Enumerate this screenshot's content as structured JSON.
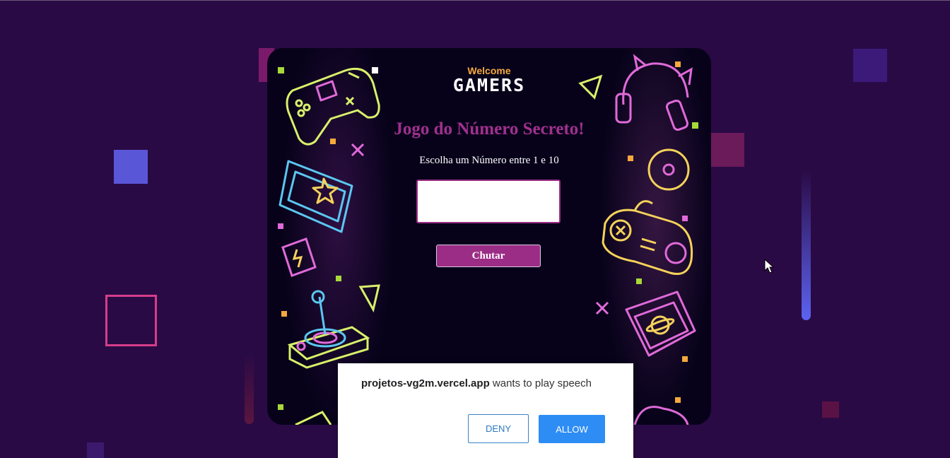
{
  "game": {
    "welcome": "Welcome",
    "gamers": "GAMERS",
    "title": "Jogo do Número Secreto!",
    "subtitle": "Escolha um Número entre 1 e 10",
    "input_value": "",
    "button_label": "Chutar"
  },
  "permission_prompt": {
    "site": "projetos-vg2m.vercel.app",
    "message": " wants to play speech",
    "deny_label": "DENY",
    "allow_label": "ALLOW"
  },
  "colors": {
    "page_background": "#2a0a45",
    "card_background": "#07021a",
    "title": "#a0308e",
    "button": "#9c2d86",
    "welcome": "#f5a93b",
    "allow_button": "#2e8df5"
  },
  "icons": [
    "gamepad-icon",
    "cartridge-icon",
    "energy-drink-icon",
    "joystick-icon",
    "headphones-icon",
    "disc-icon",
    "retro-controller-icon",
    "planet-cartridge-icon",
    "cursor-icon"
  ]
}
